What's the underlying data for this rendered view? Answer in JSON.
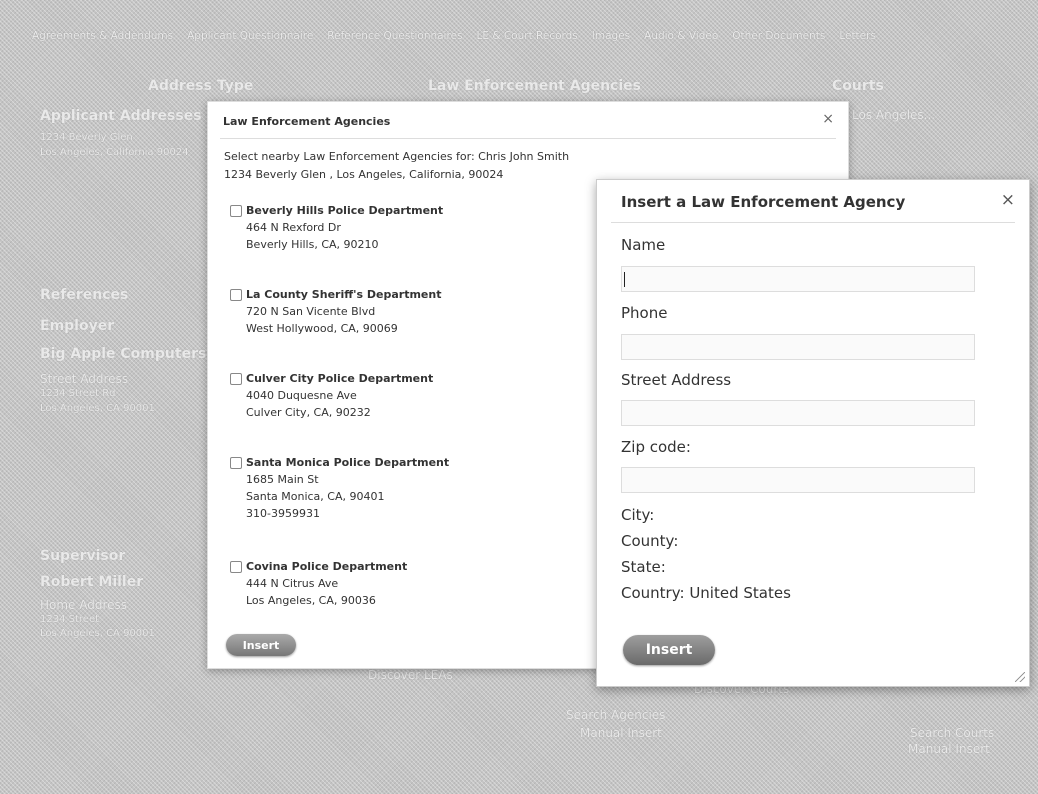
{
  "background": {
    "nav": [
      "Agreements & Addendums",
      "Applicant Questionnaire",
      "Reference Questionnaires",
      "LE & Court Records",
      "Images",
      "Audio & Video",
      "Other Documents",
      "Letters"
    ],
    "col_address_type": "Address Type",
    "col_lea": "Law Enforcement Agencies",
    "col_courts": "Courts",
    "applicant_label": "Applicant Addresses",
    "applicant_line1": "1234 Beverly Glen",
    "applicant_line2": "Los Angeles, California 90024",
    "court_item": "Los Angeles...",
    "references": "References",
    "employer": "Employer",
    "employer_name": "Big Apple Computers",
    "employer_addr_label": "Street Address",
    "employer_addr1": "1234 Street Rd",
    "employer_addr2": "Los Angeles, CA 90001",
    "supervisor": "Supervisor",
    "supervisor_name": "Robert Miller",
    "supervisor_addr_label": "Home Address",
    "supervisor_addr1": "1234 Street",
    "supervisor_addr2": "Los Angeles, CA 90001",
    "discover1": "Discover LEAs",
    "discover2": "Discover Courts",
    "search_agencies": "Search Agencies",
    "manual_insert": "Manual Insert",
    "search_courts": "Search Courts",
    "manual_insert2": "Manual Insert"
  },
  "lea_dialog": {
    "title": "Law Enforcement Agencies",
    "close": "×",
    "intro_line1": "Select nearby Law Enforcement Agencies for: Chris John Smith",
    "intro_line2": "1234 Beverly Glen , Los Angeles, California, 90024",
    "agencies": [
      {
        "name": "Beverly Hills Police Department",
        "line1": "464 N Rexford Dr",
        "line2": "Beverly Hills, CA, 90210",
        "line3": ""
      },
      {
        "name": "La County Sheriff's Department",
        "line1": "720 N San Vicente Blvd",
        "line2": "West Hollywood, CA, 90069",
        "line3": ""
      },
      {
        "name": "Culver City Police Department",
        "line1": "4040 Duquesne Ave",
        "line2": "Culver City, CA, 90232",
        "line3": ""
      },
      {
        "name": "Santa Monica Police Department",
        "line1": "1685 Main St",
        "line2": "Santa Monica, CA, 90401",
        "line3": "310-3959931"
      },
      {
        "name": "Covina Police Department",
        "line1": "444 N Citrus Ave",
        "line2": "Los Angeles, CA, 90036",
        "line3": ""
      }
    ],
    "insert_label": "Insert"
  },
  "insert_dialog": {
    "title": "Insert a Law Enforcement Agency",
    "close": "×",
    "name_label": "Name",
    "name_value": "",
    "phone_label": "Phone",
    "phone_value": "",
    "street_label": "Street Address",
    "street_value": "",
    "zip_label": "Zip code:",
    "zip_value": "",
    "city_label": "City:",
    "county_label": "County:",
    "state_label": "State:",
    "country_label": "Country: United States",
    "insert_label": "Insert"
  }
}
